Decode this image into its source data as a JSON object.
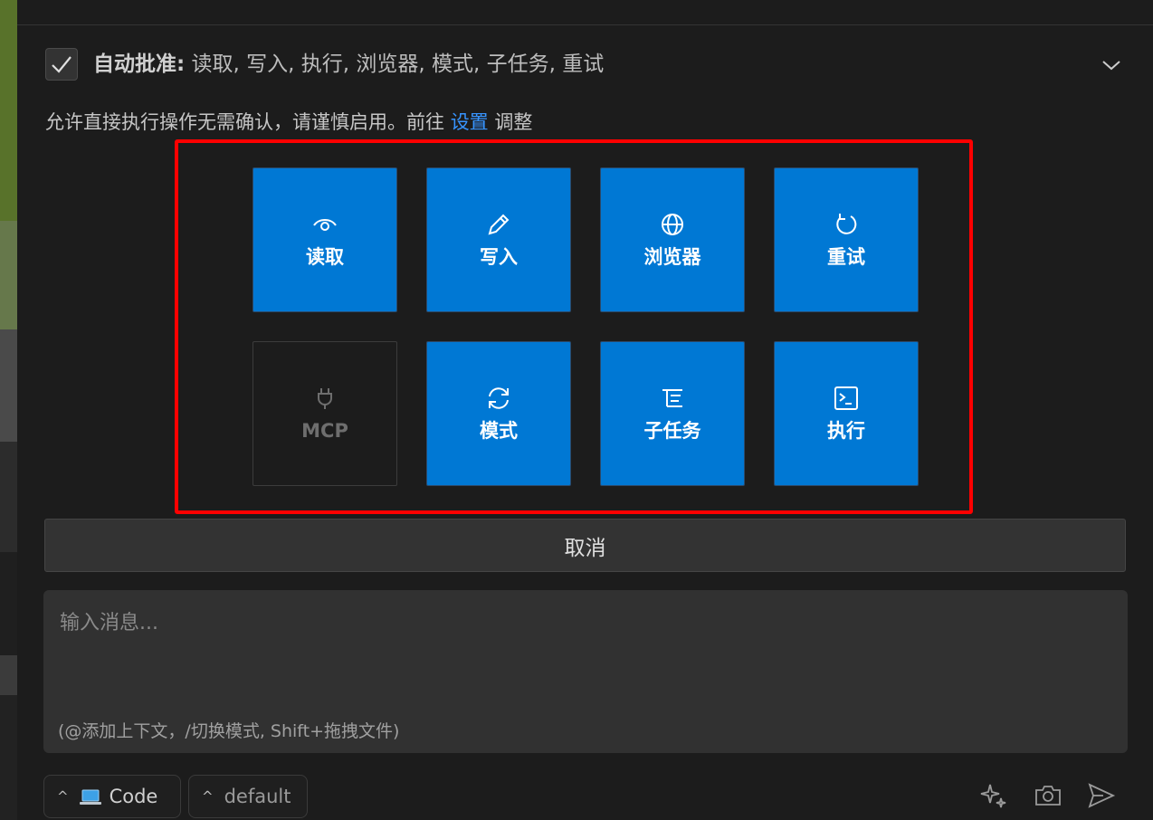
{
  "auto_approve": {
    "checked": true,
    "label": "自动批准:",
    "items_text": " 读取, 写入, 执行, 浏览器, 模式, 子任务, 重试"
  },
  "description": {
    "before": "允许直接执行操作无需确认，请谨慎启用。前往 ",
    "link": "设置",
    "after": " 调整"
  },
  "tiles": [
    {
      "label": "读取",
      "icon": "eye-icon",
      "enabled": true
    },
    {
      "label": "写入",
      "icon": "pencil-icon",
      "enabled": true
    },
    {
      "label": "浏览器",
      "icon": "globe-icon",
      "enabled": true
    },
    {
      "label": "重试",
      "icon": "refresh-icon",
      "enabled": true
    },
    {
      "label": "MCP",
      "icon": "plug-icon",
      "enabled": false
    },
    {
      "label": "模式",
      "icon": "sync-icon",
      "enabled": true
    },
    {
      "label": "子任务",
      "icon": "list-tree-icon",
      "enabled": true
    },
    {
      "label": "执行",
      "icon": "terminal-icon",
      "enabled": true
    }
  ],
  "cancel_label": "取消",
  "input": {
    "placeholder": "输入消息...",
    "hint": "(@添加上下文，/切换模式, Shift+拖拽文件)"
  },
  "footer": {
    "mode_label": "Code",
    "profile_label": "default"
  },
  "colors": {
    "accent": "#0078d4",
    "link": "#3794ff",
    "highlight_border": "#ff0000",
    "background": "#1c1c1c"
  }
}
